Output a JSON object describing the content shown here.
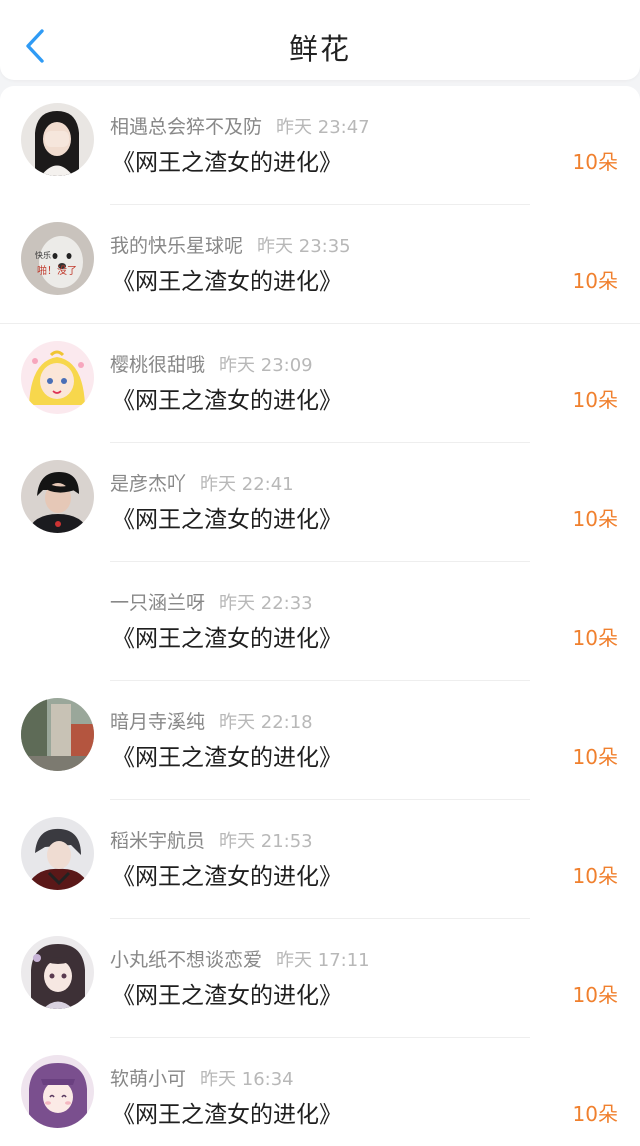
{
  "header": {
    "title": "鲜花",
    "back_icon": "chevron-left-icon",
    "accent_color": "#2f9bf5"
  },
  "colors": {
    "amount": "#f0802e",
    "name": "#888888",
    "time": "#b8b8b8"
  },
  "items": [
    {
      "name": "相遇总会猝不及防",
      "time": "昨天 23:47",
      "book": "《网王之渣女的进化》",
      "amount": "10朵",
      "avatar": "avatar-girl-hiding-face"
    },
    {
      "name": "我的快乐星球呢",
      "time": "昨天 23:35",
      "book": "《网王之渣女的进化》",
      "amount": "10朵",
      "avatar": "avatar-dog-meme",
      "avatar_text_1": "快乐",
      "avatar_text_2": "啪！没了"
    },
    {
      "name": "樱桃很甜哦",
      "time": "昨天 23:09",
      "book": "《网王之渣女的进化》",
      "amount": "10朵",
      "avatar": "avatar-sailor-moon"
    },
    {
      "name": "是彦杰吖",
      "time": "昨天 22:41",
      "book": "《网王之渣女的进化》",
      "amount": "10朵",
      "avatar": "avatar-boy-photo"
    },
    {
      "name": "一只涵兰呀",
      "time": "昨天 22:33",
      "book": "《网王之渣女的进化》",
      "amount": "10朵",
      "avatar": "avatar-empty"
    },
    {
      "name": "暗月寺溪纯",
      "time": "昨天 22:18",
      "book": "《网王之渣女的进化》",
      "amount": "10朵",
      "avatar": "avatar-street-photo"
    },
    {
      "name": "稻米宇航员",
      "time": "昨天 21:53",
      "book": "《网王之渣女的进化》",
      "amount": "10朵",
      "avatar": "avatar-anime-boy"
    },
    {
      "name": "小丸纸不想谈恋爱",
      "time": "昨天 17:11",
      "book": "《网王之渣女的进化》",
      "amount": "10朵",
      "avatar": "avatar-anime-girl"
    },
    {
      "name": "软萌小可",
      "time": "昨天 16:34",
      "book": "《网王之渣女的进化》",
      "amount": "10朵",
      "avatar": "avatar-purple-hair-girl"
    }
  ]
}
